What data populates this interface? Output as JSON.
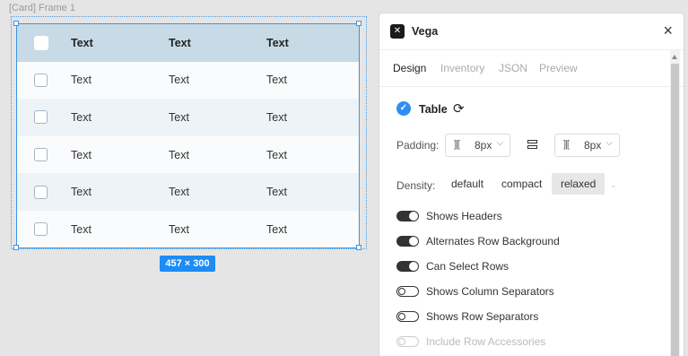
{
  "canvas": {
    "frame_label": "[Card] Frame 1",
    "size_badge": "457 × 300"
  },
  "table": {
    "headers": [
      "Text",
      "Text",
      "Text"
    ],
    "rows": [
      [
        "Text",
        "Text",
        "Text"
      ],
      [
        "Text",
        "Text",
        "Text"
      ],
      [
        "Text",
        "Text",
        "Text"
      ],
      [
        "Text",
        "Text",
        "Text"
      ],
      [
        "Text",
        "Text",
        "Text"
      ]
    ]
  },
  "panel": {
    "logo_icon": "vega-logo-icon",
    "title": "Vega",
    "close_icon": "×",
    "tabs": [
      {
        "label": "Design",
        "active": true
      },
      {
        "label": "Inventory",
        "active": false
      },
      {
        "label": "JSON",
        "active": false
      },
      {
        "label": "Preview",
        "active": false
      }
    ],
    "component": {
      "check_icon": "✓",
      "name": "Table",
      "sync_icon": "⟳"
    },
    "padding": {
      "label": "Padding:",
      "horizontal_icon": "]|[",
      "horizontal_value": "8px",
      "vertical_icon": "]|[",
      "vertical_value": "8px",
      "chevron": "⌵"
    },
    "density": {
      "label": "Density:",
      "options": [
        {
          "label": "default",
          "selected": false
        },
        {
          "label": "compact",
          "selected": false
        },
        {
          "label": "relaxed",
          "selected": true
        }
      ],
      "trailing": "-"
    },
    "toggles": [
      {
        "label": "Shows Headers",
        "state": "on"
      },
      {
        "label": "Alternates Row Background",
        "state": "on"
      },
      {
        "label": "Can Select Rows",
        "state": "on"
      },
      {
        "label": "Shows Column Separators",
        "state": "off"
      },
      {
        "label": "Shows Row Separators",
        "state": "off"
      },
      {
        "label": "Include Row Accessories",
        "state": "disabled"
      }
    ],
    "colors": {
      "accent": "#2f8ef4",
      "selection": "#3b95e8",
      "header_row": "#c7dae6",
      "alt_row": "#eef3f7"
    }
  }
}
